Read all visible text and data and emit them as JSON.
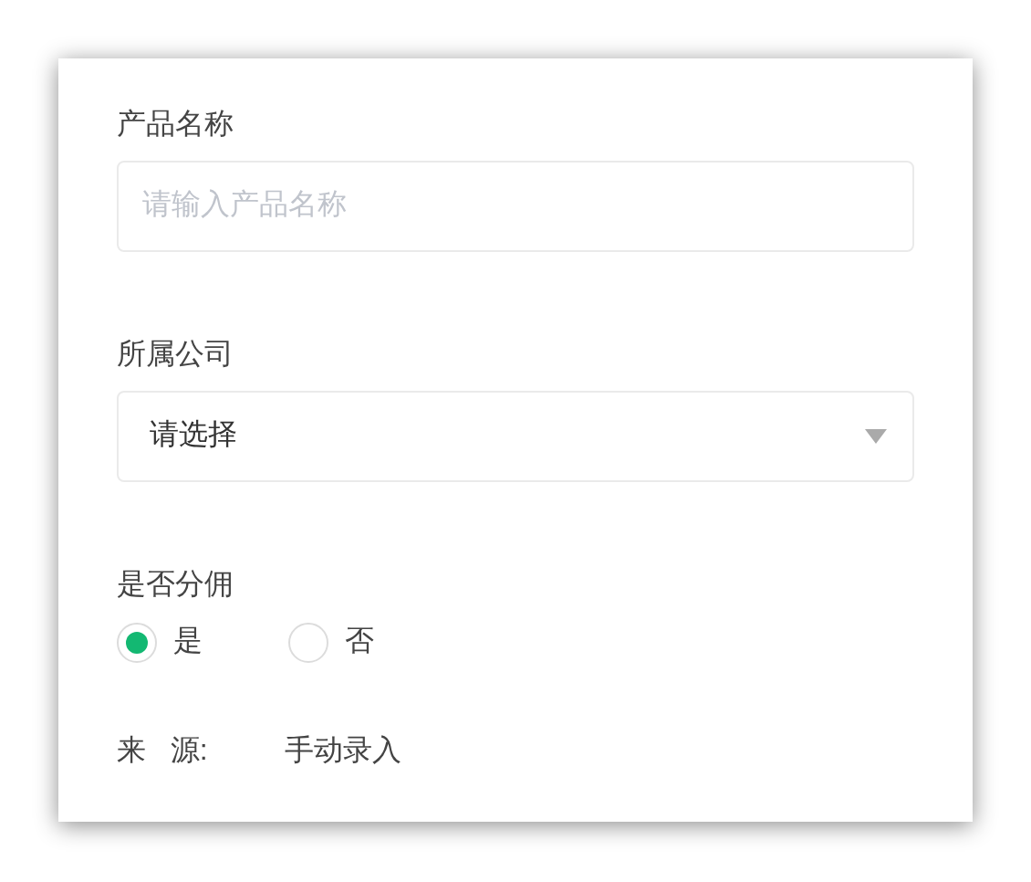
{
  "product_name": {
    "label": "产品名称",
    "placeholder": "请输入产品名称"
  },
  "company": {
    "label": "所属公司",
    "value": "请选择"
  },
  "commission": {
    "label": "是否分佣",
    "options": [
      {
        "label": "是",
        "selected": true
      },
      {
        "label": "否",
        "selected": false
      }
    ]
  },
  "source": {
    "label": "来   源:",
    "value": "手动录入"
  }
}
